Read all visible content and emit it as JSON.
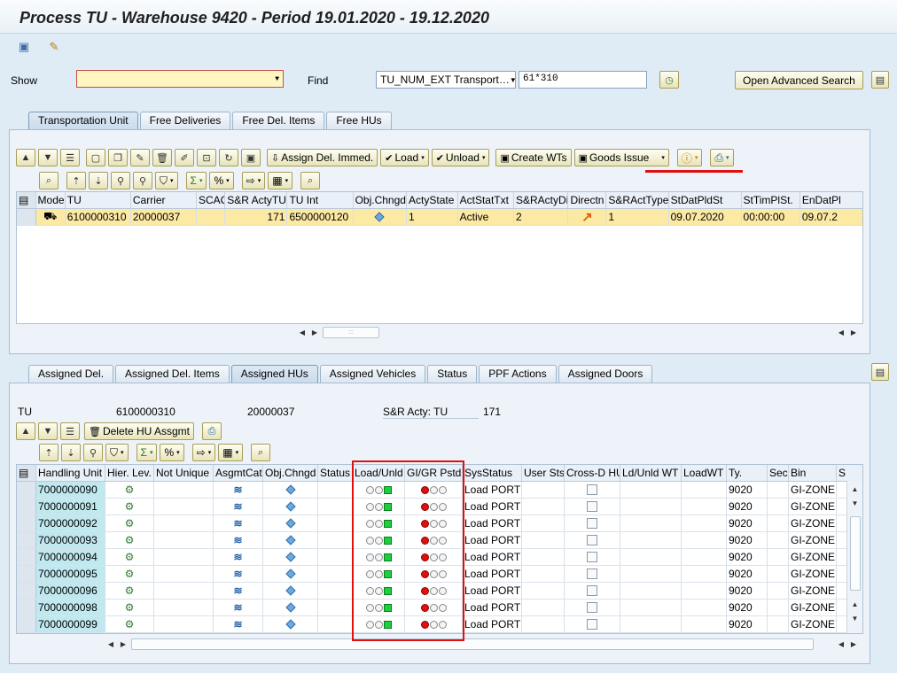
{
  "window": {
    "title": "Process TU - Warehouse 9420 - Period 19.01.2020 - 19.12.2020"
  },
  "search": {
    "show_label": "Show",
    "show_value": "",
    "find_label": "Find",
    "find_field": "TU_NUM_EXT Transport…",
    "find_value": "61*310",
    "advanced_label": "Open Advanced Search"
  },
  "top_tabs": [
    "Transportation Unit",
    "Free Deliveries",
    "Free Del. Items",
    "Free HUs"
  ],
  "top_toolbar": {
    "assign_del": "Assign Del. Immed.",
    "load": "Load",
    "unload": "Unload",
    "create_wts": "Create WTs",
    "goods_issue": "Goods Issue"
  },
  "tu_table": {
    "headers": [
      "Mode",
      "TU",
      "Carrier",
      "SCAC",
      "S&R ActyTU",
      "TU Int",
      "Obj.Chngd",
      "ActyState",
      "ActStatTxt",
      "S&RActyDir",
      "Directn",
      "S&RActType",
      "StDatPldSt",
      "StTimPlSt.",
      "EnDatPl"
    ],
    "row": {
      "tu": "6100000310",
      "carrier": "20000037",
      "scac": "",
      "sr_acty_tu": "171",
      "tu_int": "6500000120",
      "acty_state": "1",
      "act_stat_txt": "Active",
      "sr_acty_dir": "2",
      "sr_act_type": "1",
      "st_dat": "09.07.2020",
      "st_time": "00:00:00",
      "en_dat": "09.07.2"
    }
  },
  "bottom_tabs": [
    "Assigned Del.",
    "Assigned Del. Items",
    "Assigned HUs",
    "Assigned Vehicles",
    "Status",
    "PPF Actions",
    "Assigned Doors"
  ],
  "tu_info": {
    "label": "TU",
    "tu": "6100000310",
    "carrier": "20000037",
    "sr_label": "S&R Acty: TU",
    "sr_value": "171"
  },
  "hu_toolbar": {
    "delete_label": "Delete HU Assgmt"
  },
  "hu_table": {
    "headers": [
      "Handling Unit",
      "Hier. Lev.",
      "Not Unique",
      "AsgmtCat",
      "Obj.Chngd",
      "Status",
      "Load/Unld",
      "GI/GR Pstd",
      "SysStatus",
      "User Sts",
      "Cross-D HU",
      "Ld/Unld WT",
      "LoadWT",
      "Ty.",
      "Sec",
      "Bin",
      "S"
    ],
    "rows": [
      {
        "hu": "7000000090",
        "sys": "Load PORT",
        "ty": "9020",
        "bin": "GI-ZONE"
      },
      {
        "hu": "7000000091",
        "sys": "Load PORT",
        "ty": "9020",
        "bin": "GI-ZONE"
      },
      {
        "hu": "7000000092",
        "sys": "Load PORT",
        "ty": "9020",
        "bin": "GI-ZONE"
      },
      {
        "hu": "7000000093",
        "sys": "Load PORT",
        "ty": "9020",
        "bin": "GI-ZONE"
      },
      {
        "hu": "7000000094",
        "sys": "Load PORT",
        "ty": "9020",
        "bin": "GI-ZONE"
      },
      {
        "hu": "7000000095",
        "sys": "Load PORT",
        "ty": "9020",
        "bin": "GI-ZONE"
      },
      {
        "hu": "7000000096",
        "sys": "Load PORT",
        "ty": "9020",
        "bin": "GI-ZONE"
      },
      {
        "hu": "7000000098",
        "sys": "Load PORT",
        "ty": "9020",
        "bin": "GI-ZONE"
      },
      {
        "hu": "7000000099",
        "sys": "Load PORT",
        "ty": "9020",
        "bin": "GI-ZONE"
      }
    ]
  },
  "colors": {
    "selected_row": "#fbe9a4",
    "hu_cell": "#bfe8ef",
    "highlight": "#e01010",
    "tab_bar": "#dfebf5"
  }
}
